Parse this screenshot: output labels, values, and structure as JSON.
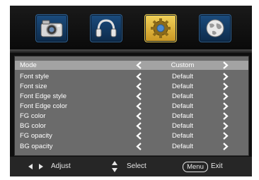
{
  "top_tabs": [
    {
      "icon": "camera-icon"
    },
    {
      "icon": "headphones-icon"
    },
    {
      "icon": "gear-icon",
      "active": true
    },
    {
      "icon": "globe-icon"
    }
  ],
  "menu": {
    "rows": [
      {
        "label": "Mode",
        "value": "Custom"
      },
      {
        "label": "Font style",
        "value": "Default"
      },
      {
        "label": "Font size",
        "value": "Default"
      },
      {
        "label": "Font Edge style",
        "value": "Default"
      },
      {
        "label": "Font Edge color",
        "value": "Default"
      },
      {
        "label": "FG color",
        "value": "Default"
      },
      {
        "label": "BG color",
        "value": "Default"
      },
      {
        "label": "FG opacity",
        "value": "Default"
      },
      {
        "label": "BG opacity",
        "value": "Default"
      }
    ]
  },
  "footer": {
    "adjust_label": "Adjust",
    "select_label": "Select",
    "menu_key": "Menu",
    "exit_label": "Exit"
  },
  "colors": {
    "panel": "#6b6b6b",
    "selected_row": "#a3a3a3",
    "active_tab": "#e8c64a",
    "tab": "#1b4c7e"
  }
}
